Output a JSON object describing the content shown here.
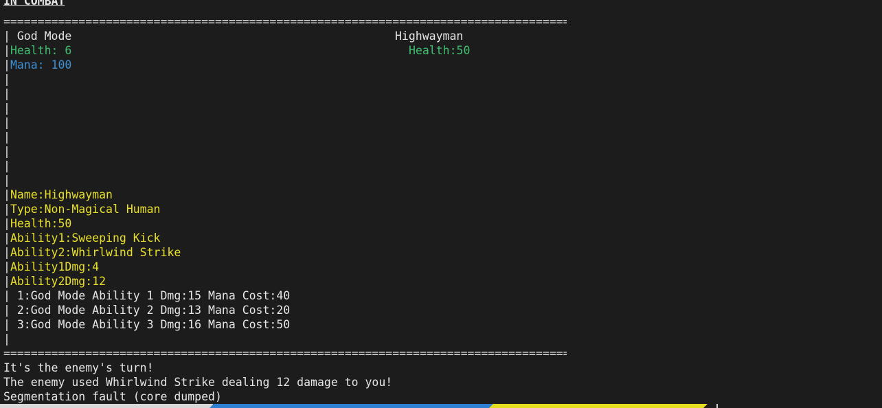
{
  "header": {
    "title": "IN COMBAT"
  },
  "rule": "================================================================================================",
  "player": {
    "name": "God Mode",
    "health": "Health: 6",
    "mana": "Mana: 100",
    "abilities": [
      "1:God Mode Ability 1 Dmg:15 Mana Cost:40",
      "2:God Mode Ability 2 Dmg:13 Mana Cost:20",
      "3:God Mode Ability 3 Dmg:16 Mana Cost:50"
    ]
  },
  "enemy": {
    "name": "Highwayman",
    "health": "Health:50",
    "info": [
      "Name:Highwayman",
      "Type:Non-Magical Human",
      "Health:50",
      "Ability1:Sweeping Kick",
      "Ability2:Whirlwind Strike",
      "Ability1Dmg:4",
      "Ability2Dmg:12"
    ]
  },
  "border": "|",
  "messages": [
    "It's the enemy's turn!",
    "The enemy used Whirlwind Strike dealing 12 damage to you!",
    "Segmentation fault (core dumped)"
  ],
  "colors": {
    "health": "#3fbf6f",
    "mana": "#3d8fd6",
    "enemy_info": "#e8e02a",
    "background": "#1c1c1c"
  }
}
